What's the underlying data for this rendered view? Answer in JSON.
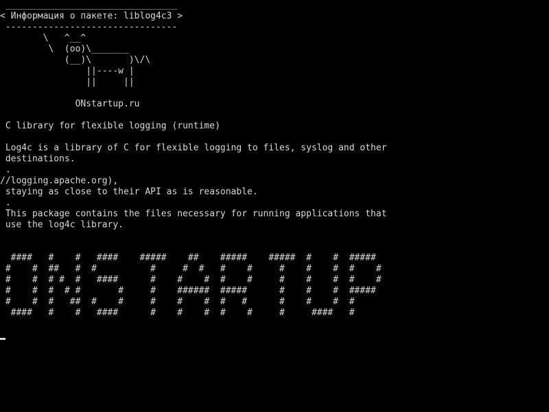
{
  "screen": {
    "background_color": "#000000",
    "text_color": "#d8d8d8",
    "lines": [
      " ________________________________",
      "< Информация о пакете: liblog4c3 >",
      " --------------------------------",
      "        \\   ^__^",
      "         \\  (oo)\\_______",
      "            (__)\\       )\\/\\",
      "                ||----w |",
      "                ||     ||",
      "",
      "              ONstartup.ru",
      "",
      " C library for flexible logging (runtime)",
      "",
      " Log4c is a library of C for flexible logging to files, syslog and other",
      " destinations.",
      " .",
      "//logging.apache.org),",
      " staying as close to their API as is reasonable.",
      " .",
      " This package contains the files necessary for running applications that",
      " use the log4c library.",
      "",
      "",
      "  ####   #    #   ####    #####    ##    #####    #####  #    #  #####",
      " #    #  ##   #  #          #     #  #   #    #     #    #    #  #    #",
      " #    #  # #  #   ####      #    #    #  #    #     #    #    #  #    #",
      " #    #  #  # #       #     #    ######  #####      #    #    #  #####",
      " #    #  #   ##  #    #     #    #    #  #   #      #    #    #  #",
      "  ####   #    #   ####      #    #    #  #    #     #     ####   #"
    ]
  }
}
